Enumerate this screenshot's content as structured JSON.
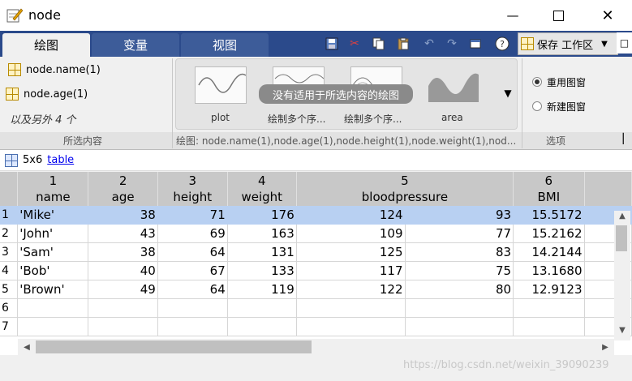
{
  "window": {
    "title": "node"
  },
  "tabs": [
    "绘图",
    "变量",
    "视图"
  ],
  "layout": {
    "label": "保存 工作区"
  },
  "ribbon": {
    "selection": [
      "node.name(1)",
      "node.age(1)"
    ],
    "selection_more": "以及另外 4 个",
    "selection_section_label": "所选内容",
    "plot_section_label": "绘图: node.name(1),node.age(1),node.height(1),node.weight(1),nod...",
    "options_section_label": "选项",
    "plots": [
      "plot",
      "绘制多个序...",
      "绘制多个序...",
      "area"
    ],
    "no_plot_message": "没有适用于所选内容的绘图",
    "options": [
      {
        "label": "重用图窗",
        "selected": true
      },
      {
        "label": "新建图窗",
        "selected": false
      }
    ]
  },
  "varbar": {
    "size": "5x6",
    "type": "table"
  },
  "table": {
    "column_numbers": [
      "1",
      "2",
      "3",
      "4",
      "5",
      "6"
    ],
    "column_names": [
      "name",
      "age",
      "height",
      "weight",
      "bloodpressure",
      "BMI"
    ],
    "rows": [
      {
        "row": "1",
        "cells": [
          "'Mike'",
          "38",
          "71",
          "176",
          "124",
          "93",
          "15.5172"
        ]
      },
      {
        "row": "2",
        "cells": [
          "'John'",
          "43",
          "69",
          "163",
          "109",
          "77",
          "15.2162"
        ]
      },
      {
        "row": "3",
        "cells": [
          "'Sam'",
          "38",
          "64",
          "131",
          "125",
          "83",
          "14.2144"
        ]
      },
      {
        "row": "4",
        "cells": [
          "'Bob'",
          "40",
          "67",
          "133",
          "117",
          "75",
          "13.1680"
        ]
      },
      {
        "row": "5",
        "cells": [
          "'Brown'",
          "49",
          "64",
          "119",
          "122",
          "80",
          "12.9123"
        ]
      },
      {
        "row": "6",
        "cells": [
          "",
          "",
          "",
          "",
          "",
          "",
          ""
        ]
      },
      {
        "row": "7",
        "cells": [
          "",
          "",
          "",
          "",
          "",
          "",
          ""
        ]
      }
    ],
    "selected_row": 0
  },
  "watermark": "https://blog.csdn.net/weixin_39090239"
}
